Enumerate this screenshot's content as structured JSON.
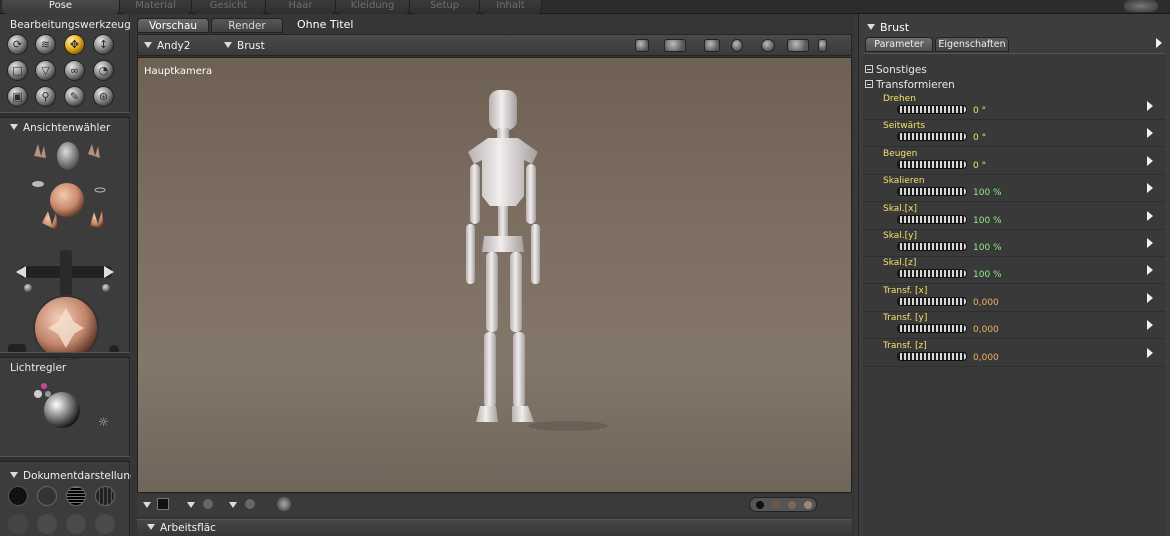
{
  "room_tabs": [
    "Pose",
    "Material",
    "Gesicht",
    "Haar",
    "Kleidung",
    "Setup",
    "Inhalt"
  ],
  "active_room": "Pose",
  "left_panel": {
    "tools_title": "Bearbeitungswerkzeuge",
    "tool_icons": [
      "rotate-icon",
      "twist-icon",
      "translate-icon",
      "translate-in-out-icon",
      "scale-icon",
      "taper-icon",
      "chain-break-icon",
      "color-icon",
      "grouping-icon",
      "view-magnifier-icon",
      "morph-brush-icon",
      "direct-manipulation-icon"
    ],
    "view_selector_title": "Ansichtenwähler",
    "light_title": "Lichtregler",
    "display_title": "Dokumentdarstellung"
  },
  "center": {
    "tabs": [
      "Vorschau",
      "Render"
    ],
    "active_tab": "Vorschau",
    "document_title": "Ohne Titel",
    "figure_select": "Andy2",
    "actor_select": "Brust",
    "camera_label": "Hauptkamera",
    "workspace_label": "Arbeitsfläc"
  },
  "right_panel": {
    "header": "Brust",
    "tabs": [
      "Parameter",
      "Eigenschaften"
    ],
    "active_tab": "Parameter",
    "groups": [
      "Sonstiges",
      "Transformieren"
    ],
    "parameters": [
      {
        "label": "Drehen",
        "value": "0 °",
        "color": "#f5e06a"
      },
      {
        "label": "Seitwärts",
        "value": "0 °",
        "color": "#f5e06a"
      },
      {
        "label": "Beugen",
        "value": "0 °",
        "color": "#f5e06a"
      },
      {
        "label": "Skalieren",
        "value": "100 %",
        "color": "#8ef08a"
      },
      {
        "label": "Skal.[x]",
        "value": "100 %",
        "color": "#8ef08a"
      },
      {
        "label": "Skal.[y]",
        "value": "100 %",
        "color": "#8ef08a"
      },
      {
        "label": "Skal.[z]",
        "value": "100 %",
        "color": "#8ef08a"
      },
      {
        "label": "Transf. [x]",
        "value": "0,000",
        "color": "#f0b060"
      },
      {
        "label": "Transf. [y]",
        "value": "0,000",
        "color": "#f0b060"
      },
      {
        "label": "Transf. [z]",
        "value": "0,000",
        "color": "#f0b060"
      }
    ]
  },
  "colors": {
    "accent": "#e6b01e",
    "param_label": "#f5e06a"
  }
}
